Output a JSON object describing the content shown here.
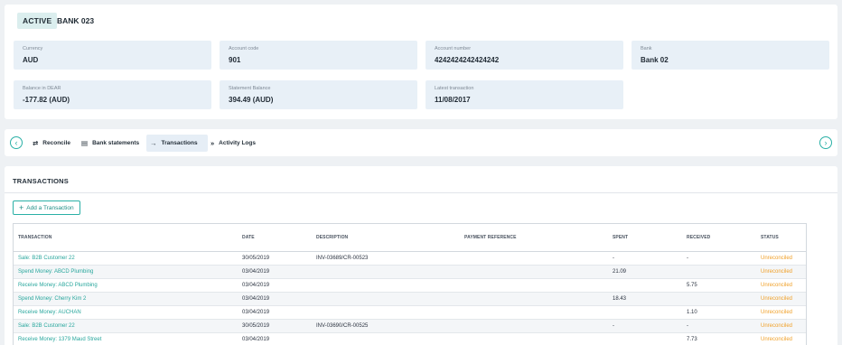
{
  "header": {
    "status": "ACTIVE",
    "title": "BANK 023",
    "fields": [
      {
        "label": "Currency",
        "value": "AUD"
      },
      {
        "label": "Account code",
        "value": "901"
      },
      {
        "label": "Account number",
        "value": "4242424242424242"
      },
      {
        "label": "Bank",
        "value": "Bank 02"
      },
      {
        "label": "Balance in DEAR",
        "value": "-177.82 (AUD)"
      },
      {
        "label": "Statement Balance",
        "value": "394.49 (AUD)"
      },
      {
        "label": "Latest transaction",
        "value": "11/08/2017"
      }
    ]
  },
  "tabs": [
    {
      "label": "Reconcile",
      "icon": "swap-arrows-icon"
    },
    {
      "label": "Bank statements",
      "icon": "document-icon"
    },
    {
      "label": "Transactions",
      "icon": "arrow-right-icon"
    },
    {
      "label": "Activity Logs",
      "icon": "chevrons-right-icon"
    }
  ],
  "nav": {
    "prev": "‹",
    "next": "›"
  },
  "transactions": {
    "title": "TRANSACTIONS",
    "add_label": "Add a Transaction",
    "columns": [
      "TRANSACTION",
      "DATE",
      "DESCRIPTION",
      "PAYMENT REFERENCE",
      "SPENT",
      "RECEIVED",
      "STATUS"
    ],
    "rows": [
      [
        "Sale: B2B Customer 22",
        "30/05/2019",
        "INV-03689/CR-00523",
        "",
        "-",
        "-",
        "Unreconciled"
      ],
      [
        "Spend Money: ABCD Plumbing",
        "03/04/2019",
        "",
        "",
        "21.09",
        "",
        "Unreconciled"
      ],
      [
        "Receive Money: ABCD Plumbing",
        "03/04/2019",
        "",
        "",
        "",
        "5.75",
        "Unreconciled"
      ],
      [
        "Spend Money: Cherry Kim 2",
        "03/04/2019",
        "",
        "",
        "18.43",
        "",
        "Unreconciled"
      ],
      [
        "Receive Money: AUCHAN",
        "03/04/2019",
        "",
        "",
        "",
        "1.10",
        "Unreconciled"
      ],
      [
        "Sale: B2B Customer 22",
        "30/05/2019",
        "INV-03690/CR-00525",
        "",
        "-",
        "-",
        "Unreconciled"
      ],
      [
        "Receive Money: 1379 Maud Street",
        "03/04/2019",
        "",
        "",
        "",
        "7.73",
        "Unreconciled"
      ]
    ]
  }
}
